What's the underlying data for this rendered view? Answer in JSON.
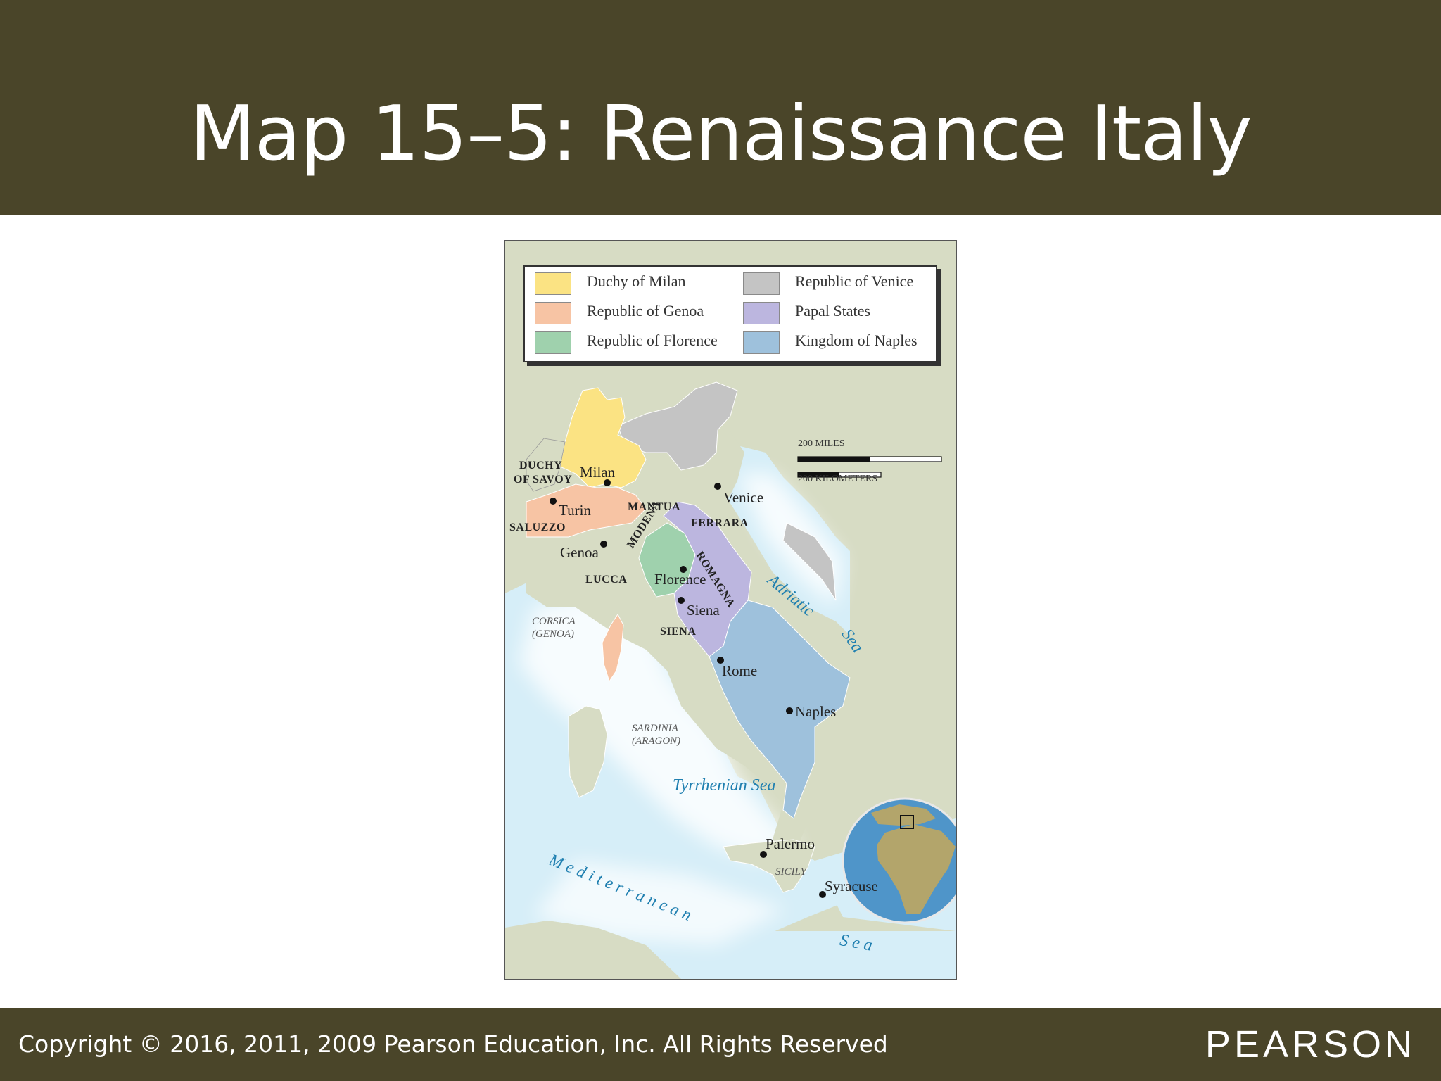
{
  "title": "Map 15–5: Renaissance Italy",
  "footer": {
    "copyright": "Copyright © 2016, 2011, 2009 Pearson Education, Inc. All Rights Reserved",
    "brand": "PEARSON"
  },
  "colors": {
    "band": "#4a4529",
    "land": "#d7dcc4",
    "water": "#d6eef8"
  },
  "legend": [
    {
      "label": "Duchy of Milan",
      "color": "#fbe383"
    },
    {
      "label": "Republic of Genoa",
      "color": "#f7c4a4"
    },
    {
      "label": "Republic of Florence",
      "color": "#9fd1ad"
    },
    {
      "label": "Republic of Venice",
      "color": "#c4c4c4"
    },
    {
      "label": "Papal States",
      "color": "#bcb6df"
    },
    {
      "label": "Kingdom of Naples",
      "color": "#9ec1dc"
    }
  ],
  "scale": {
    "miles": "200 MILES",
    "kilometers": "200 KILOMETERS"
  },
  "cities": {
    "milan": "Milan",
    "turin": "Turin",
    "genoa": "Genoa",
    "venice": "Venice",
    "florence": "Florence",
    "siena": "Siena",
    "rome": "Rome",
    "naples": "Naples",
    "palermo": "Palermo",
    "syracuse": "Syracuse"
  },
  "states": {
    "duchy_of_savoy_1": "DUCHY",
    "duchy_of_savoy_2": "OF SAVOY",
    "saluzzo": "SALUZZO",
    "mantua": "MANTUA",
    "ferrara": "FERRARA",
    "modena": "MODENA",
    "romagna": "ROMAGNA",
    "lucca": "LUCCA",
    "siena": "SIENA"
  },
  "islands": {
    "corsica_1": "CORSICA",
    "corsica_2": "(GENOA)",
    "sardinia_1": "SARDINIA",
    "sardinia_2": "(ARAGON)",
    "sicily": "SICILY"
  },
  "seas": {
    "adriatic_1": "Adriatic",
    "adriatic_2": "Sea",
    "tyrrhenian": "Tyrrhenian Sea",
    "mediterranean_1": "M e d i t e r r a n e a n",
    "mediterranean_2": "S e a"
  }
}
